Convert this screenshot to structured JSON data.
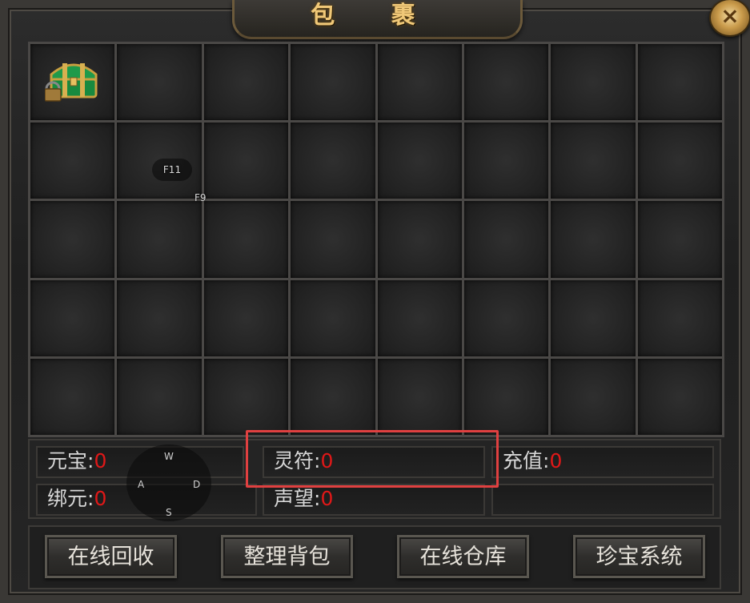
{
  "window": {
    "title": "包 裹",
    "close_label": "×"
  },
  "inventory": {
    "rows": 5,
    "columns": 8,
    "items": [
      {
        "slot": 0,
        "icon": "locked-treasure-chest-icon"
      }
    ]
  },
  "hotkeys": {
    "f11": "F11",
    "f9": "F9",
    "w": "W",
    "a": "A",
    "d": "D",
    "s": "S"
  },
  "currency": {
    "yuanbao": {
      "label": "元宝:",
      "value": "0"
    },
    "bangyuan": {
      "label": "绑元:",
      "value": "0"
    },
    "lingfu": {
      "label": "灵符:",
      "value": "0"
    },
    "shengwang": {
      "label": "声望:",
      "value": "0"
    },
    "chongzhi": {
      "label": "充值:",
      "value": "0"
    }
  },
  "buttons": {
    "online_recycle": "在线回收",
    "sort_bag": "整理背包",
    "online_storage": "在线仓库",
    "treasure_system": "珍宝系统"
  },
  "colors": {
    "value_red": "#e01818",
    "title_gold": "#f0c878",
    "highlight": "#e04040"
  }
}
